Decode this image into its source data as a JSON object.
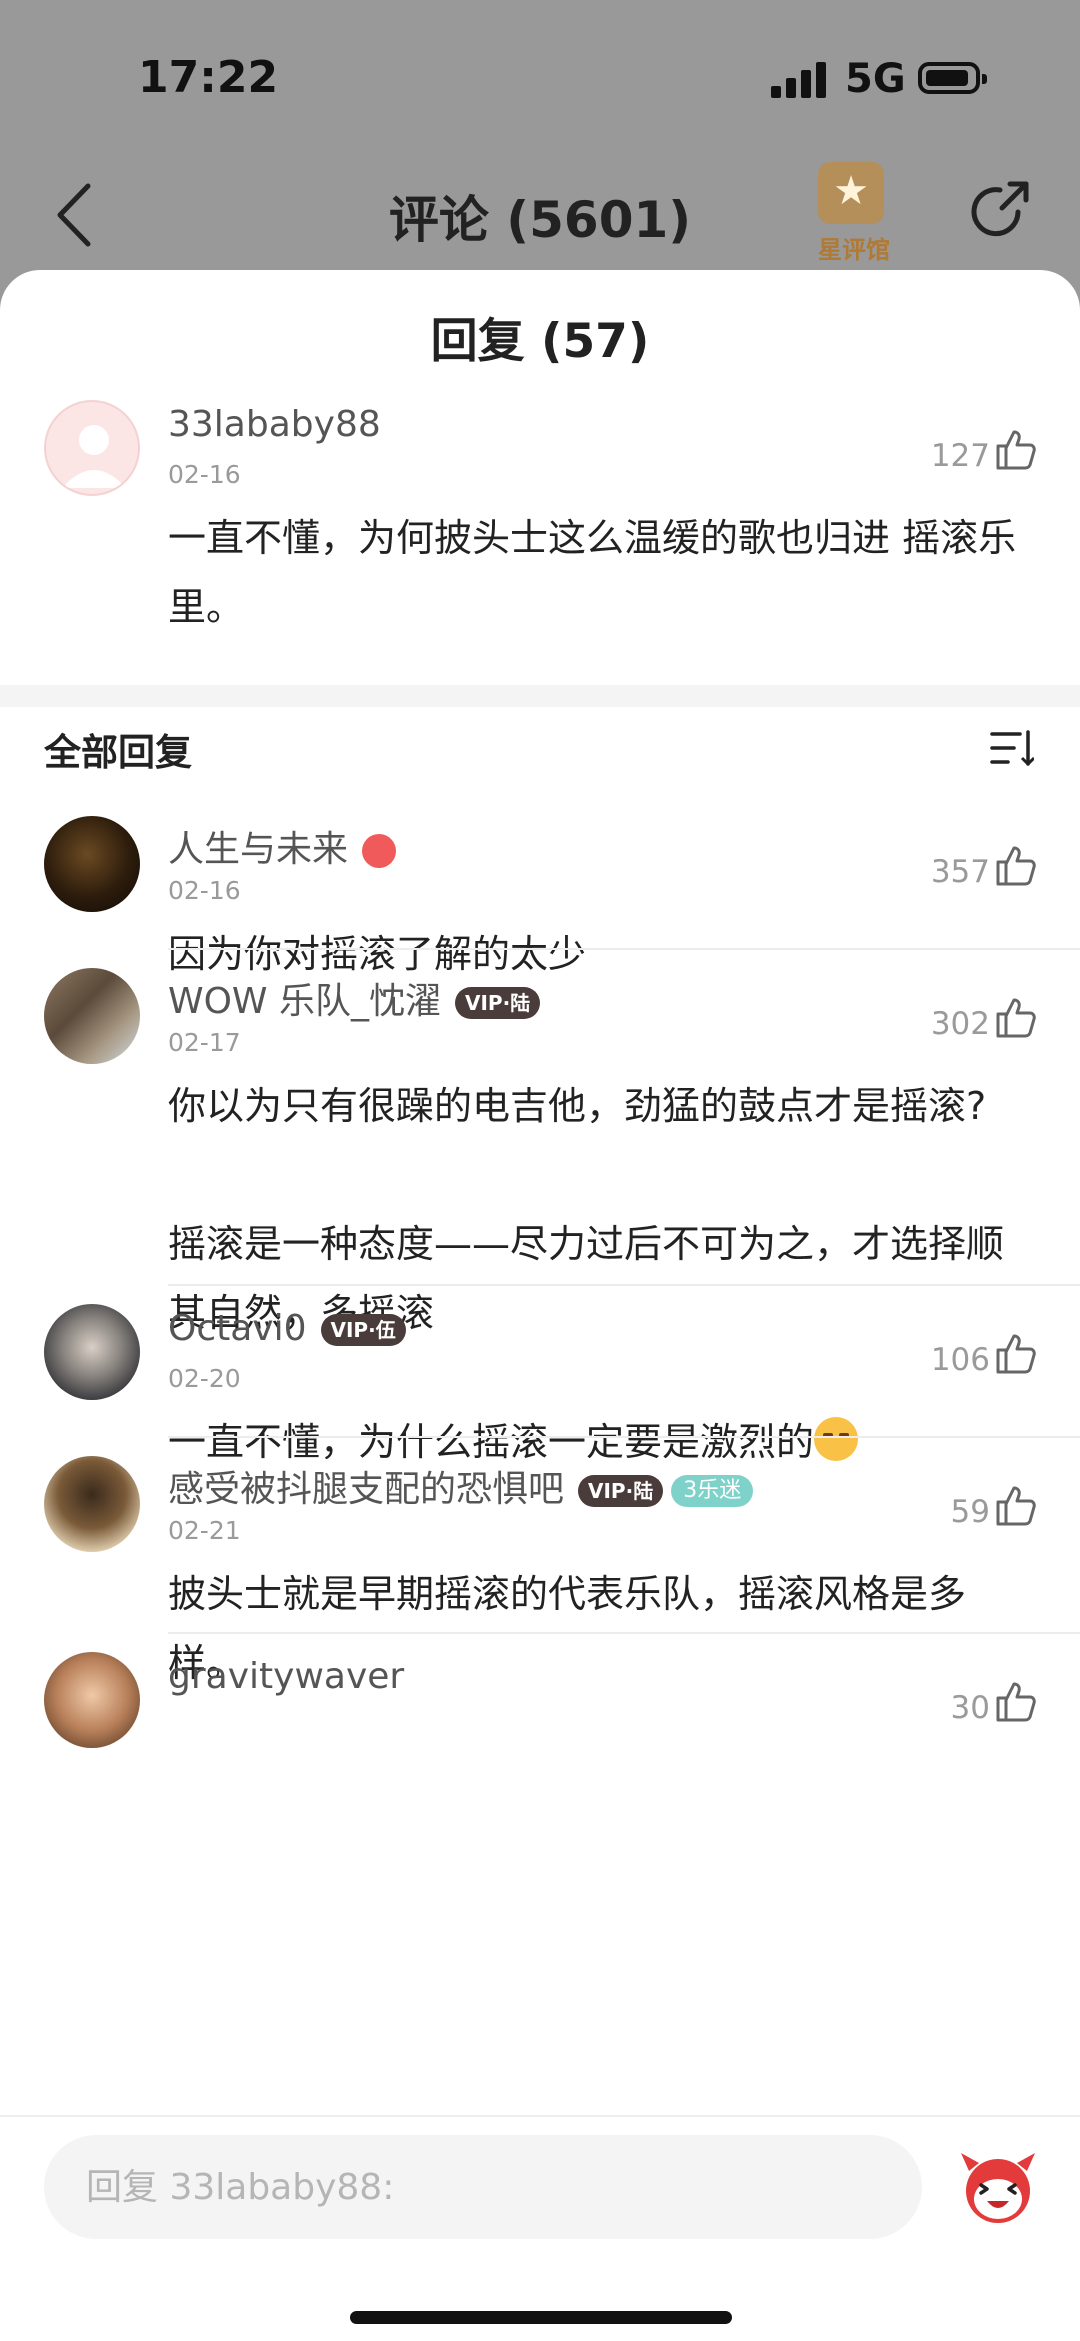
{
  "status_bar": {
    "time": "17:22",
    "network": "5G"
  },
  "nav": {
    "title": "评论 (5601)",
    "brand_text": "星评馆"
  },
  "sheet": {
    "title": "回复 (57)"
  },
  "parent_comment": {
    "username": "33lababy88",
    "date": "02-16",
    "likes": "127",
    "text": "一直不懂，为何披头士这么温缓的歌也归进 摇滚乐 里。"
  },
  "section": {
    "title": "全部回复"
  },
  "replies": [
    {
      "username": "人生与未来",
      "date": "02-16",
      "likes": "357",
      "text": "因为你对摇滚了解的太少"
    },
    {
      "username": "WOW 乐队_忱濯",
      "badge": "VIP·陆",
      "date": "02-17",
      "likes": "302",
      "text": "你以为只有很躁的电吉他，劲猛的鼓点才是摇滚?\n\n摇滚是一种态度——尽力过后不可为之，才选择顺其自然，多摇滚"
    },
    {
      "username": "Octavi0",
      "badge": "VIP·伍",
      "date": "02-20",
      "likes": "106",
      "text": "一直不懂，为什么摇滚一定要是激烈的"
    },
    {
      "username": "感受被抖腿支配的恐惧吧",
      "badge": "VIP·陆",
      "fan_badge": "3乐迷",
      "date": "02-21",
      "likes": "59",
      "text": "披头士就是早期摇滚的代表乐队，摇滚风格是多样。"
    },
    {
      "username": "gravitywaver",
      "likes": "30"
    }
  ],
  "input": {
    "placeholder": "回复 33lababy88:"
  },
  "colors": {
    "accent": "#f05a5a",
    "vip_badge": "#4a3c3a",
    "fan_badge": "#7fd2c9"
  }
}
